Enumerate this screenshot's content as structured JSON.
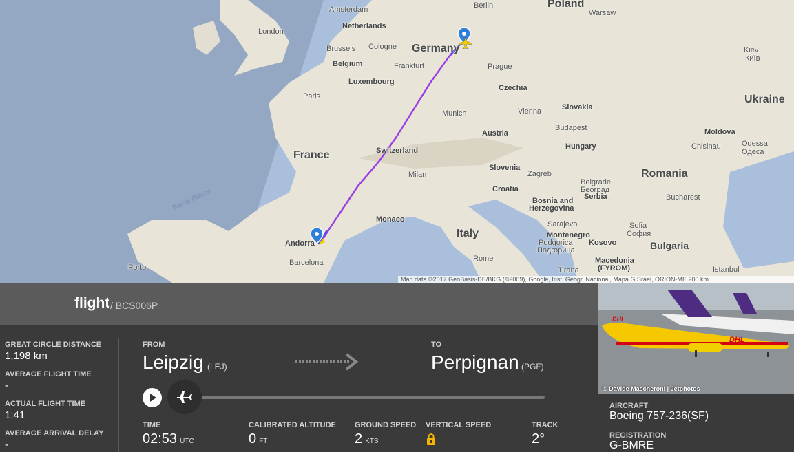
{
  "map": {
    "labels": {
      "amsterdam": "Amsterdam",
      "berlin": "Berlin",
      "poland": "Poland",
      "warsaw": "Warsaw",
      "london": "London",
      "netherlands": "Netherlands",
      "brussels": "Brussels",
      "cologne": "Cologne",
      "germany": "Germany",
      "belgium": "Belgium",
      "frankfurt": "Frankfurt",
      "prague": "Prague",
      "kyiv": "Kiev",
      "kyiv_local": "Київ",
      "luxembourg": "Luxembourg",
      "czechia": "Czechia",
      "paris": "Paris",
      "ukraine": "Ukraine",
      "munich": "Munich",
      "vienna": "Vienna",
      "slovakia": "Slovakia",
      "france": "France",
      "austria": "Austria",
      "budapest": "Budapest",
      "moldova": "Moldova",
      "switzerland": "Switzerland",
      "hungary": "Hungary",
      "chisinau": "Chisinau",
      "odessa": "Odessa",
      "odessa_local": "Одеса",
      "slovenia": "Slovenia",
      "zagreb": "Zagreb",
      "milan": "Milan",
      "romania": "Romania",
      "bay_of_biscay": "Bay of Biscay",
      "belgrade": "Belgrade",
      "belgrade_local": "Београд",
      "croatia": "Croatia",
      "serbia": "Serbia",
      "bucharest": "Bucharest",
      "bosnia": "Bosnia and",
      "herzegovina": "Herzegovina",
      "monaco": "Monaco",
      "sarajevo": "Sarajevo",
      "sofia": "Sofia",
      "sofia_local": "София",
      "montenegro": "Montenegro",
      "podgorica": "Podgorica",
      "podgorica_local": "Подгорица",
      "italy": "Italy",
      "kosovo": "Kosovo",
      "bulgaria": "Bulgaria",
      "andorra": "Andorra",
      "porto": "Porto",
      "barcelona": "Barcelona",
      "rome": "Rome",
      "macedonia": "Macedonia",
      "fyrom": "(FYROM)",
      "tirana": "Tirana",
      "istanbul": "Istanbul"
    },
    "attribution": "Map data ©2017 GeoBasis-DE/BKG (©2009), Google, Inst. Geogr. Nacional, Mapa GISrael, ORION-ME   200 km"
  },
  "header": {
    "title": "flight",
    "callsign": "/ BCS006P"
  },
  "stats": [
    {
      "label": "GREAT CIRCLE DISTANCE",
      "value": "1,198 km"
    },
    {
      "label": "AVERAGE FLIGHT TIME",
      "value": "-"
    },
    {
      "label": "ACTUAL FLIGHT TIME",
      "value": "1:41"
    },
    {
      "label": "AVERAGE ARRIVAL DELAY",
      "value": "-"
    }
  ],
  "route": {
    "from_label": "FROM",
    "from_city": "Leipzig",
    "from_code": "(LEJ)",
    "to_label": "TO",
    "to_city": "Perpignan",
    "to_code": "(PGF)"
  },
  "metrics": [
    {
      "label": "TIME",
      "value": "02:53",
      "unit": "UTC"
    },
    {
      "label": "CALIBRATED ALTITUDE",
      "value": "0",
      "unit": "FT"
    },
    {
      "label": "GROUND SPEED",
      "value": "2",
      "unit": "KTS"
    },
    {
      "label": "VERTICAL SPEED",
      "value": "",
      "unit": ""
    },
    {
      "label": "TRACK",
      "value": "2°",
      "unit": ""
    }
  ],
  "photo": {
    "credit": "© Davide Mascheroni | Jetphotos"
  },
  "aircraft": {
    "aircraft_label": "AIRCRAFT",
    "aircraft_value": "Boeing 757-236(SF)",
    "registration_label": "REGISTRATION",
    "registration_value": "G-BMRE"
  },
  "colors": {
    "panel": "#3a3a3a",
    "header": "#5b5b5b",
    "track_purple": "#9b3fe0",
    "track_blue": "#4a4af0",
    "marker": "#2f7fd8"
  }
}
